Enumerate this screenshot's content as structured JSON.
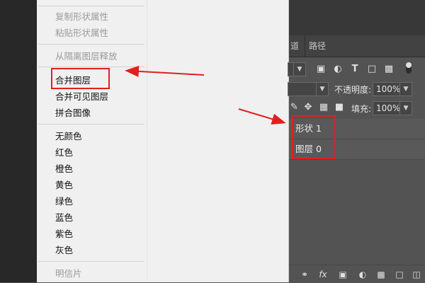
{
  "menu": {
    "items": [
      {
        "label": "复制形状属性",
        "disabled": true
      },
      {
        "label": "粘贴形状属性",
        "disabled": true
      },
      {
        "label": "从隔离图层释放",
        "disabled": true
      },
      {
        "label": "合并图层",
        "disabled": false
      },
      {
        "label": "合并可见图层",
        "disabled": false
      },
      {
        "label": "拼合图像",
        "disabled": false
      },
      {
        "label": "无颜色",
        "disabled": false
      },
      {
        "label": "红色",
        "disabled": false
      },
      {
        "label": "橙色",
        "disabled": false
      },
      {
        "label": "黄色",
        "disabled": false
      },
      {
        "label": "绿色",
        "disabled": false
      },
      {
        "label": "蓝色",
        "disabled": false
      },
      {
        "label": "紫色",
        "disabled": false
      },
      {
        "label": "灰色",
        "disabled": false
      },
      {
        "label": "明信片",
        "disabled": true
      }
    ]
  },
  "panel": {
    "tabs": [
      "道",
      "路径"
    ],
    "opacity_label": "不透明度:",
    "opacity_value": "100%",
    "fill_label": "填充:",
    "fill_value": "100%",
    "layers": [
      {
        "name": "形状 1"
      },
      {
        "name": "图层 0"
      }
    ],
    "filter_icons": [
      "image-icon",
      "adjustment-icon",
      "type-icon",
      "shape-icon",
      "smart-object-icon",
      "toggle-icon"
    ],
    "lock_icons": [
      "lock-pixels-icon",
      "move-icon",
      "artboard-icon",
      "lock-all-icon"
    ],
    "bottom_icons": [
      "link-icon",
      "fx-icon",
      "mask-icon",
      "adjustment-layer-icon",
      "group-icon",
      "new-layer-icon",
      "trash-icon"
    ]
  },
  "annotation_color": "#e21f1f"
}
